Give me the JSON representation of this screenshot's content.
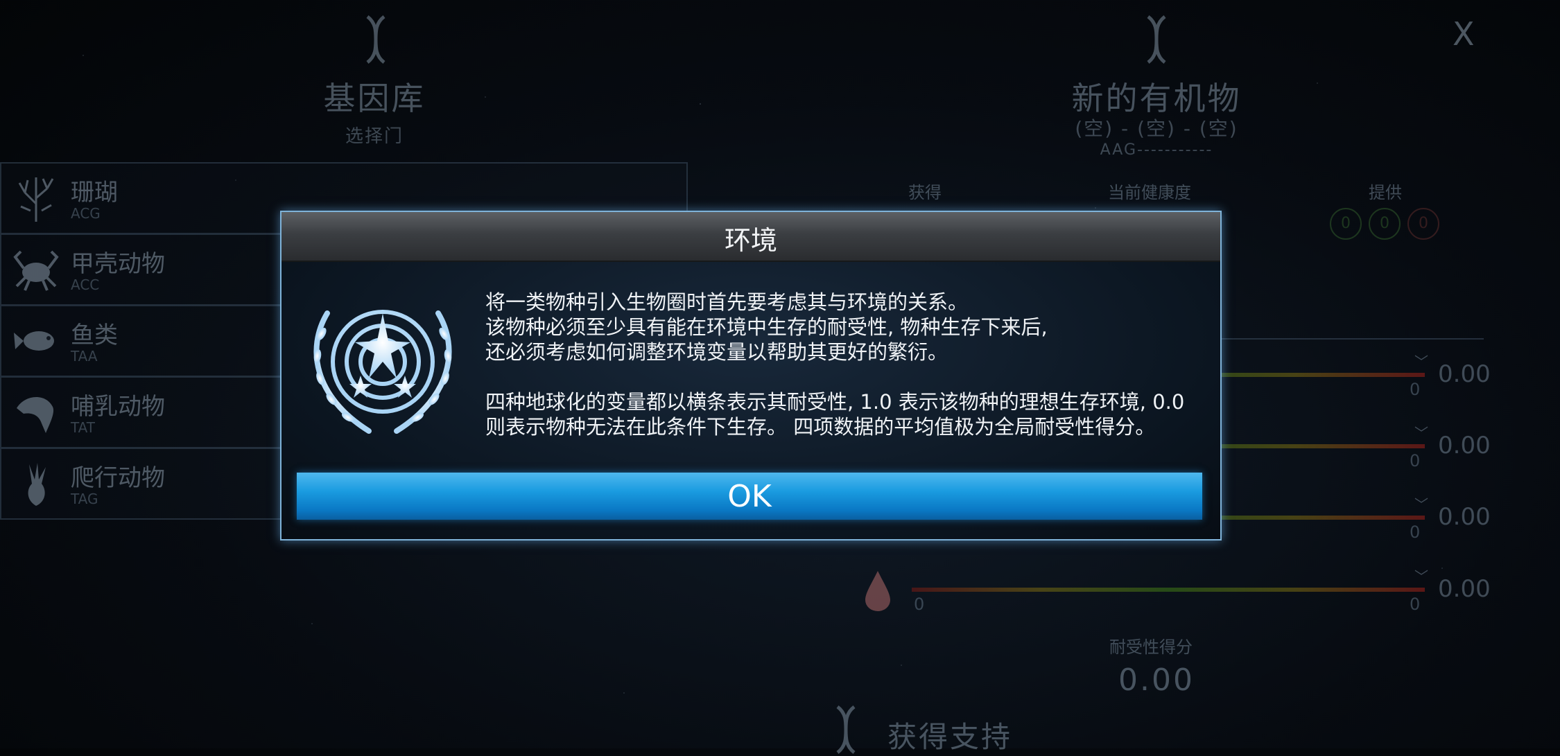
{
  "left_panel": {
    "title": "基因库",
    "subtitle": "选择门",
    "items": [
      {
        "name": "珊瑚",
        "code": "ACG",
        "icon": "coral-icon"
      },
      {
        "name": "甲壳动物",
        "code": "ACC",
        "icon": "crab-icon"
      },
      {
        "name": "鱼类",
        "code": "TAA",
        "icon": "fish-icon"
      },
      {
        "name": "哺乳动物",
        "code": "TAT",
        "icon": "dolphin-icon"
      },
      {
        "name": "爬行动物",
        "code": "TAG",
        "icon": "footprint-icon"
      }
    ]
  },
  "right_panel": {
    "title": "新的有机物",
    "slots": "(空) - (空) - (空)",
    "sequence": "AAG-----------",
    "columns": {
      "gain": "获得",
      "health": "当前健康度",
      "provide": "提供"
    },
    "provide_circles": [
      "0",
      "0",
      "0"
    ],
    "bars": [
      {
        "min": "0",
        "value": "0.00"
      },
      {
        "min": "0",
        "value": "0.00"
      },
      {
        "min": "0",
        "value": "0.00"
      },
      {
        "min": "0",
        "value": "0.00"
      }
    ],
    "tolerance_label": "耐受性得分",
    "tolerance_value": "0.00",
    "get_support": "获得支持"
  },
  "close_label": "X",
  "dialog": {
    "title": "环境",
    "lines": [
      "将一类物种引入生物圈时首先要考虑其与环境的关系。",
      "该物种必须至少具有能在环境中生存的耐受性, 物种生存下来后,",
      "还必须考虑如何调整环境变量以帮助其更好的繁衍。",
      "四种地球化的变量都以横条表示其耐受性, 1.0 表示该物种的理想生存环境, 0.0",
      "则表示物种无法在此条件下生存。 四项数据的平均值极为全局耐受性得分。"
    ],
    "ok_label": "OK"
  },
  "colors": {
    "accent": "#1a9be0",
    "dialog_border": "#7fb3d9"
  }
}
